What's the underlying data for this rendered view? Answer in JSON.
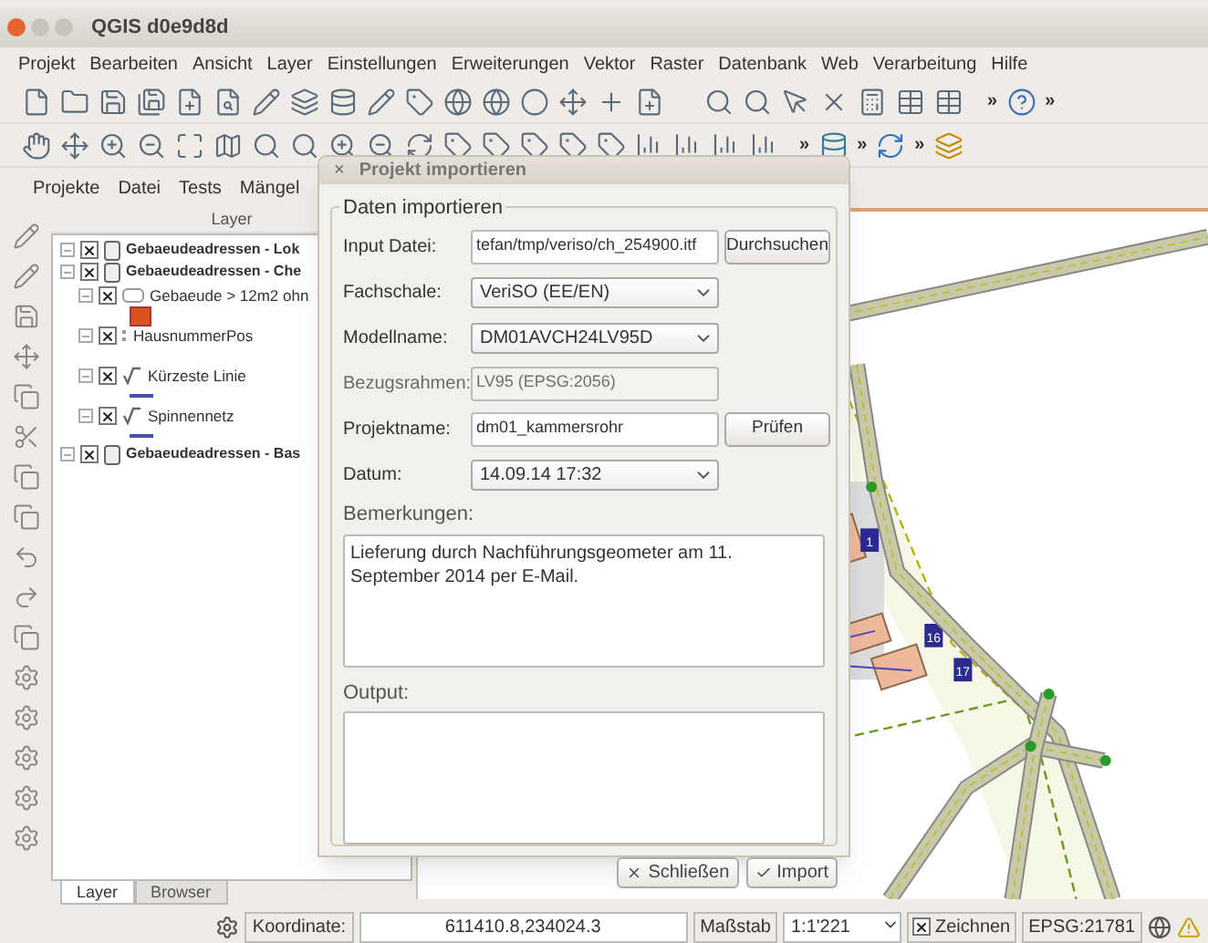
{
  "window": {
    "title": "QGIS d0e9d8d"
  },
  "menu": [
    "Projekt",
    "Bearbeiten",
    "Ansicht",
    "Layer",
    "Einstellungen",
    "Erweiterungen",
    "Vektor",
    "Raster",
    "Datenbank",
    "Web",
    "Verarbeitung",
    "Hilfe"
  ],
  "toolbar_overflow": [
    "»",
    "»",
    "»",
    "»",
    "»"
  ],
  "plugin_menu": [
    "Projekte",
    "Datei",
    "Tests",
    "Mängel"
  ],
  "layer_panel": {
    "title": "Layer",
    "layers": [
      {
        "name": "Gebaeudeadressen - Lok",
        "kind": "group",
        "checked": true
      },
      {
        "name": "Gebaeudeadressen - Che",
        "kind": "group",
        "checked": true,
        "children": [
          {
            "name": "Gebaeude > 12m2 ohn",
            "kind": "polygon",
            "checked": true
          },
          {
            "name": "HausnummerPos",
            "kind": "point",
            "checked": true
          },
          {
            "name": "Kürzeste Linie",
            "kind": "line",
            "checked": true
          },
          {
            "name": "Spinnennetz",
            "kind": "line",
            "checked": true
          }
        ]
      },
      {
        "name": "Gebaeudeadressen - Bas",
        "kind": "group",
        "checked": true
      }
    ],
    "tabs": [
      {
        "label": "Layer",
        "selected": true
      },
      {
        "label": "Browser",
        "selected": false
      }
    ]
  },
  "dialog": {
    "title": "Projekt importieren",
    "close": "×",
    "group_title": "Daten importieren",
    "fields": [
      {
        "label": "Input Datei:",
        "kind": "text",
        "value": "tefan/tmp/veriso/ch_254900.itf",
        "button": "Durchsuchen",
        "disabled": false
      },
      {
        "label": "Fachschale:",
        "kind": "combo",
        "value": "VeriSO (EE/EN)",
        "disabled": false
      },
      {
        "label": "Modellname:",
        "kind": "combo",
        "value": "DM01AVCH24LV95D",
        "disabled": false
      },
      {
        "label": "Bezugsrahmen:",
        "kind": "text",
        "value": "LV95 (EPSG:2056)",
        "disabled": true
      },
      {
        "label": "Projektname:",
        "kind": "text",
        "value": "dm01_kammersrohr",
        "button": "Prüfen",
        "disabled": false
      },
      {
        "label": "Datum:",
        "kind": "combo",
        "value": "14.09.14 17:32",
        "disabled": false
      }
    ],
    "remarks_label": "Bemerkungen:",
    "remarks": "Lieferung durch Nachführungsgeometer am 11. September 2014 per E-Mail.",
    "output_label": "Output:",
    "buttons": [
      "Schließen",
      "Import"
    ]
  },
  "map": {
    "labels": [
      "1",
      "16",
      "17"
    ]
  },
  "status_bar": {
    "coordinate_label": "Koordinate:",
    "coordinate": "611410.8,234024.3",
    "scale_label": "Maßstab",
    "scale": "1:1'221",
    "render_label": "Zeichnen",
    "render_checked": true,
    "crs": "EPSG:21781"
  }
}
